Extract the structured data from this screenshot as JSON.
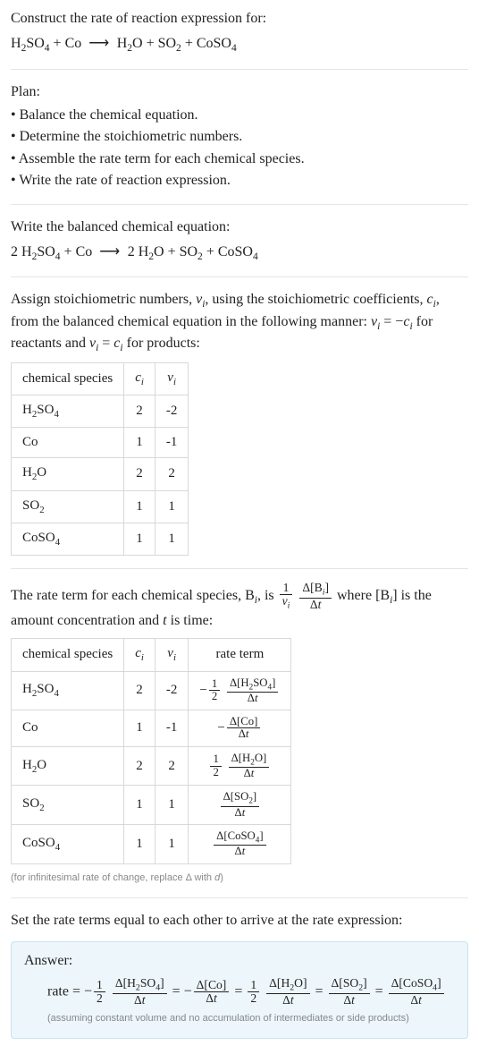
{
  "header": {
    "prompt": "Construct the rate of reaction expression for:",
    "equation_html": "H<span class='sub'>2</span>SO<span class='sub'>4</span> + Co &nbsp;<span class='arrow'>&#10230;</span>&nbsp; H<span class='sub'>2</span>O + SO<span class='sub'>2</span> + CoSO<span class='sub'>4</span>"
  },
  "plan": {
    "title": "Plan:",
    "items": [
      "• Balance the chemical equation.",
      "• Determine the stoichiometric numbers.",
      "• Assemble the rate term for each chemical species.",
      "• Write the rate of reaction expression."
    ]
  },
  "balanced": {
    "intro": "Write the balanced chemical equation:",
    "equation_html": "2 H<span class='sub'>2</span>SO<span class='sub'>4</span> + Co &nbsp;<span class='arrow'>&#10230;</span>&nbsp; 2 H<span class='sub'>2</span>O + SO<span class='sub'>2</span> + CoSO<span class='sub'>4</span>"
  },
  "assign": {
    "text_html": "Assign stoichiometric numbers, <span class='italic'>&nu;</span><span class='sub italic'>i</span>, using the stoichiometric coefficients, <span class='italic'>c</span><span class='sub italic'>i</span>, from the balanced chemical equation in the following manner: <span class='italic'>&nu;</span><span class='sub italic'>i</span> = &minus;<span class='italic'>c</span><span class='sub italic'>i</span> for reactants and <span class='italic'>&nu;</span><span class='sub italic'>i</span> = <span class='italic'>c</span><span class='sub italic'>i</span> for products:",
    "table": {
      "headers": [
        "chemical species",
        "c_i",
        "nu_i"
      ],
      "headers_html": [
        "chemical species",
        "<span class='italic'>c</span><span class='sub italic'>i</span>",
        "<span class='italic'>&nu;</span><span class='sub italic'>i</span>"
      ],
      "rows": [
        {
          "species_html": "H<span class='sub'>2</span>SO<span class='sub'>4</span>",
          "c": "2",
          "nu": "-2"
        },
        {
          "species_html": "Co",
          "c": "1",
          "nu": "-1"
        },
        {
          "species_html": "H<span class='sub'>2</span>O",
          "c": "2",
          "nu": "2"
        },
        {
          "species_html": "SO<span class='sub'>2</span>",
          "c": "1",
          "nu": "1"
        },
        {
          "species_html": "CoSO<span class='sub'>4</span>",
          "c": "1",
          "nu": "1"
        }
      ]
    }
  },
  "rate_term_intro": {
    "before_html": "The rate term for each chemical species, B<span class='sub italic'>i</span>, is ",
    "frac1_num_html": "1",
    "frac1_den_html": "<span class='italic'>&nu;</span><span class='sub italic'>i</span>",
    "frac2_num_html": "&Delta;[B<span class='sub italic'>i</span>]",
    "frac2_den_html": "&Delta;<span class='italic'>t</span>",
    "after_html": " where [B<span class='sub italic'>i</span>] is the amount concentration and <span class='italic'>t</span> is time:"
  },
  "rate_table": {
    "headers_html": [
      "chemical species",
      "<span class='italic'>c</span><span class='sub italic'>i</span>",
      "<span class='italic'>&nu;</span><span class='sub italic'>i</span>",
      "rate term"
    ],
    "rows": [
      {
        "species_html": "H<span class='sub'>2</span>SO<span class='sub'>4</span>",
        "c": "2",
        "nu": "-2",
        "term_html": "&minus;<span class='frac'><span class='num'>1</span><span class='den'>2</span></span> <span class='frac'><span class='num'>&Delta;[H<span class='sub'>2</span>SO<span class='sub'>4</span>]</span><span class='den'>&Delta;<span class='italic'>t</span></span></span>"
      },
      {
        "species_html": "Co",
        "c": "1",
        "nu": "-1",
        "term_html": "&minus;<span class='frac'><span class='num'>&Delta;[Co]</span><span class='den'>&Delta;<span class='italic'>t</span></span></span>"
      },
      {
        "species_html": "H<span class='sub'>2</span>O",
        "c": "2",
        "nu": "2",
        "term_html": "<span class='frac'><span class='num'>1</span><span class='den'>2</span></span> <span class='frac'><span class='num'>&Delta;[H<span class='sub'>2</span>O]</span><span class='den'>&Delta;<span class='italic'>t</span></span></span>"
      },
      {
        "species_html": "SO<span class='sub'>2</span>",
        "c": "1",
        "nu": "1",
        "term_html": "<span class='frac'><span class='num'>&Delta;[SO<span class='sub'>2</span>]</span><span class='den'>&Delta;<span class='italic'>t</span></span></span>"
      },
      {
        "species_html": "CoSO<span class='sub'>4</span>",
        "c": "1",
        "nu": "1",
        "term_html": "<span class='frac'><span class='num'>&Delta;[CoSO<span class='sub'>4</span>]</span><span class='den'>&Delta;<span class='italic'>t</span></span></span>"
      }
    ],
    "footnote_html": "(for infinitesimal rate of change, replace &Delta; with <span class='italic'>d</span>)"
  },
  "final_intro": "Set the rate terms equal to each other to arrive at the rate expression:",
  "answer": {
    "label": "Answer:",
    "equation_html": "rate = &minus;<span class='frac'><span class='num'>1</span><span class='den'>2</span></span> <span class='frac'><span class='num'>&Delta;[H<span class='sub'>2</span>SO<span class='sub'>4</span>]</span><span class='den'>&Delta;<span class='italic'>t</span></span></span> = &minus;<span class='frac'><span class='num'>&Delta;[Co]</span><span class='den'>&Delta;<span class='italic'>t</span></span></span> = <span class='frac'><span class='num'>1</span><span class='den'>2</span></span> <span class='frac'><span class='num'>&Delta;[H<span class='sub'>2</span>O]</span><span class='den'>&Delta;<span class='italic'>t</span></span></span> = <span class='frac'><span class='num'>&Delta;[SO<span class='sub'>2</span>]</span><span class='den'>&Delta;<span class='italic'>t</span></span></span> = <span class='frac'><span class='num'>&Delta;[CoSO<span class='sub'>4</span>]</span><span class='den'>&Delta;<span class='italic'>t</span></span></span>",
    "assumption": "(assuming constant volume and no accumulation of intermediates or side products)"
  },
  "chart_data": {
    "type": "table",
    "tables": [
      {
        "title": "stoichiometric numbers",
        "columns": [
          "chemical species",
          "c_i",
          "nu_i"
        ],
        "rows": [
          [
            "H2SO4",
            2,
            -2
          ],
          [
            "Co",
            1,
            -1
          ],
          [
            "H2O",
            2,
            2
          ],
          [
            "SO2",
            1,
            1
          ],
          [
            "CoSO4",
            1,
            1
          ]
        ]
      },
      {
        "title": "rate terms",
        "columns": [
          "chemical species",
          "c_i",
          "nu_i",
          "rate term"
        ],
        "rows": [
          [
            "H2SO4",
            2,
            -2,
            "-(1/2) d[H2SO4]/dt"
          ],
          [
            "Co",
            1,
            -1,
            "- d[Co]/dt"
          ],
          [
            "H2O",
            2,
            2,
            "(1/2) d[H2O]/dt"
          ],
          [
            "SO2",
            1,
            1,
            "d[SO2]/dt"
          ],
          [
            "CoSO4",
            1,
            1,
            "d[CoSO4]/dt"
          ]
        ]
      }
    ]
  }
}
